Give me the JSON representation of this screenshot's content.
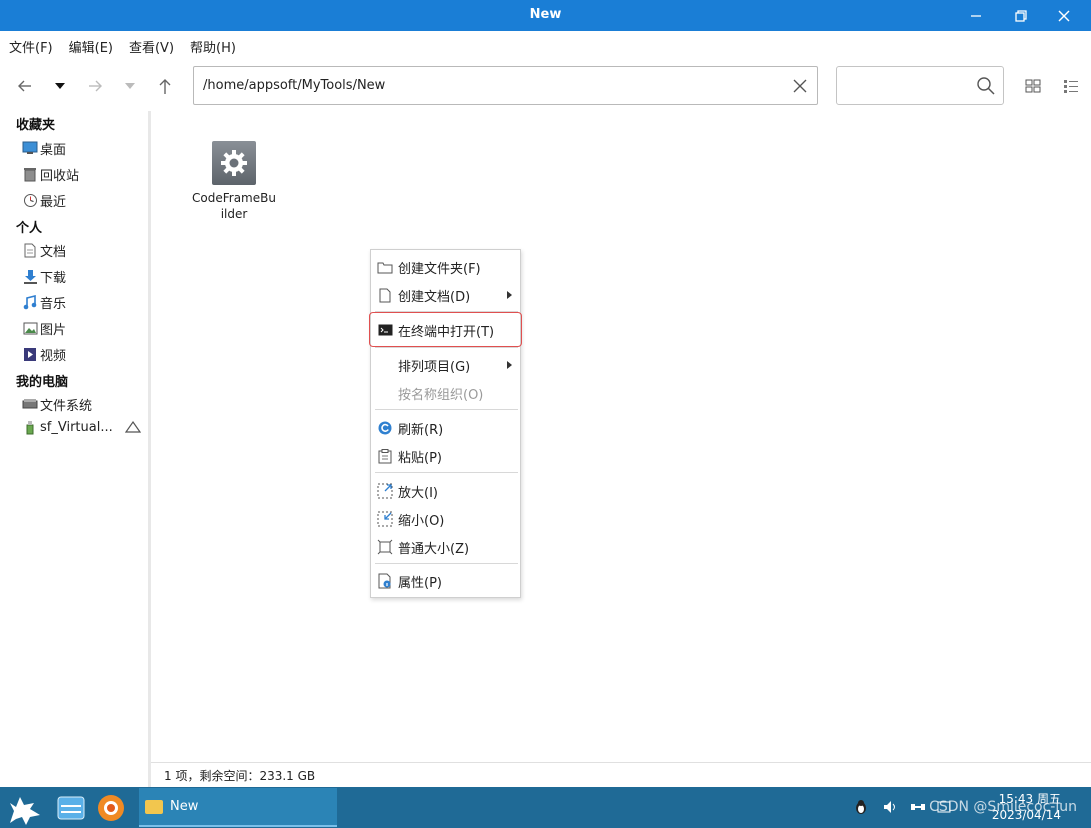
{
  "window": {
    "title": "New"
  },
  "menu": [
    "文件(F)",
    "编辑(E)",
    "查看(V)",
    "帮助(H)"
  ],
  "address": {
    "path": "/home/appsoft/MyTools/New"
  },
  "search": {
    "placeholder": ""
  },
  "sidebar": {
    "sections": [
      {
        "label": "收藏夹",
        "items": [
          "桌面",
          "回收站",
          "最近"
        ]
      },
      {
        "label": "个人",
        "items": [
          "文档",
          "下载",
          "音乐",
          "图片",
          "视频"
        ]
      },
      {
        "label": "我的电脑",
        "items": [
          "文件系统",
          "sf_Virtual..."
        ]
      }
    ]
  },
  "files": [
    {
      "name": "CodeFrameBuilder",
      "icon": "gear-icon"
    }
  ],
  "context_menu": {
    "items": [
      {
        "label": "创建文件夹(F)",
        "icon": "folder-icon",
        "enabled": true
      },
      {
        "label": "创建文档(D)",
        "icon": "document-icon",
        "enabled": true,
        "submenu": true
      },
      {
        "label": "在终端中打开(T)",
        "icon": "terminal-icon",
        "enabled": true,
        "highlighted": true
      },
      {
        "label": "排列项目(G)",
        "icon": "",
        "enabled": true,
        "submenu": true
      },
      {
        "label": "按名称组织(O)",
        "icon": "",
        "enabled": false
      },
      {
        "label": "刷新(R)",
        "icon": "refresh-icon",
        "enabled": true
      },
      {
        "label": "粘贴(P)",
        "icon": "paste-icon",
        "enabled": true
      },
      {
        "label": "放大(I)",
        "icon": "zoom-in-icon",
        "enabled": true
      },
      {
        "label": "缩小(O)",
        "icon": "zoom-out-icon",
        "enabled": true
      },
      {
        "label": "普通大小(Z)",
        "icon": "normal-size-icon",
        "enabled": true
      },
      {
        "label": "属性(P)",
        "icon": "properties-icon",
        "enabled": true
      }
    ]
  },
  "status": {
    "text": "1 项，剩余空间：233.1 GB"
  },
  "taskbar": {
    "active_window": "New",
    "clock_time": "15:43 周五",
    "clock_date": "2023/04/14",
    "watermark": "CSDN @Smilecoc-jun"
  },
  "colors": {
    "titlebar": "#1a7ed6",
    "taskbar": "#1f6a96",
    "highlight_border": "#e05050"
  }
}
